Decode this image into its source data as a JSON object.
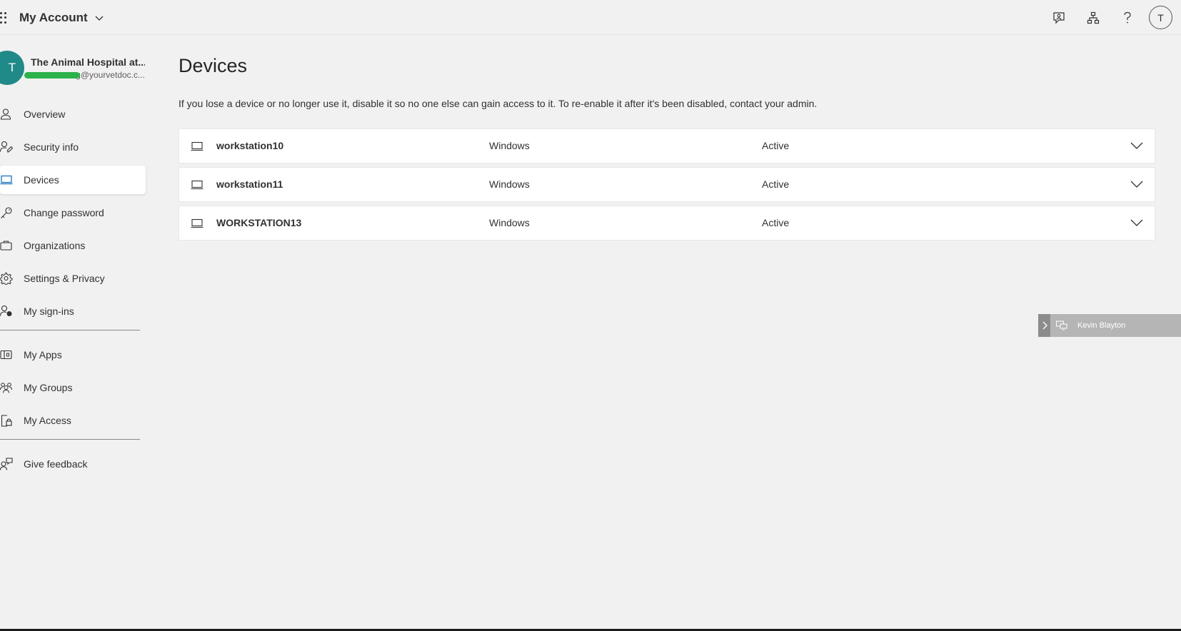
{
  "header": {
    "app_title": "My Account",
    "icons": [
      "feedback-icon",
      "org-chart-icon",
      "help-icon"
    ],
    "user_initial": "T"
  },
  "profile": {
    "initial": "T",
    "org_name": "The Animal Hospital at...",
    "email": "g@yourvetdoc.c..."
  },
  "sidebar": {
    "items": [
      {
        "label": "Overview",
        "icon": "person-icon"
      },
      {
        "label": "Security info",
        "icon": "security-info-icon"
      },
      {
        "label": "Devices",
        "icon": "laptop-icon",
        "active": true
      },
      {
        "label": "Change password",
        "icon": "key-icon"
      },
      {
        "label": "Organizations",
        "icon": "briefcase-icon"
      },
      {
        "label": "Settings & Privacy",
        "icon": "gear-icon"
      },
      {
        "label": "My sign-ins",
        "icon": "sign-ins-icon"
      }
    ],
    "apps": [
      {
        "label": "My Apps",
        "icon": "apps-icon"
      },
      {
        "label": "My Groups",
        "icon": "groups-icon"
      },
      {
        "label": "My Access",
        "icon": "access-icon"
      }
    ],
    "feedback": {
      "label": "Give feedback",
      "icon": "give-feedback-icon"
    }
  },
  "main": {
    "title": "Devices",
    "description": "If you lose a device or no longer use it, disable it so no one else can gain access to it. To re-enable it after it's been disabled, contact your admin.",
    "devices": [
      {
        "name": "workstation10",
        "os": "Windows",
        "status": "Active"
      },
      {
        "name": "workstation11",
        "os": "Windows",
        "status": "Active"
      },
      {
        "name": "WORKSTATION13",
        "os": "Windows",
        "status": "Active"
      }
    ]
  },
  "remote_panel": {
    "name": "Kevin Blayton"
  },
  "colors": {
    "background": "#f2f1f1",
    "avatar": "#1f8a88",
    "active_icon": "#0f6cbd",
    "redaction": "#2bb34a"
  }
}
